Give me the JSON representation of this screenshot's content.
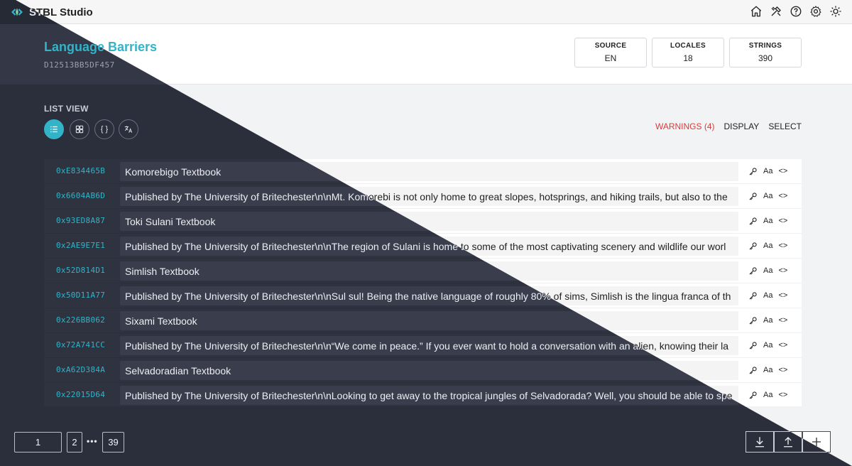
{
  "app": {
    "title": "STBL Studio"
  },
  "topbar": {
    "icons": [
      "home-icon",
      "tools-icon",
      "help-icon",
      "settings-icon",
      "theme-sun-icon"
    ]
  },
  "project": {
    "title": "Language Barriers",
    "id": "D12513BB5DF457"
  },
  "stats": [
    {
      "label": "SOURCE",
      "value": "EN"
    },
    {
      "label": "LOCALES",
      "value": "18"
    },
    {
      "label": "STRINGS",
      "value": "390"
    }
  ],
  "view": {
    "label": "LIST VIEW",
    "buttons": [
      {
        "name": "list-view",
        "glyph": "list-icon",
        "active": true
      },
      {
        "name": "grid-view",
        "glyph": "grid-icon",
        "active": false
      },
      {
        "name": "json-view",
        "glyph": "{ }",
        "active": false
      },
      {
        "name": "translate-view",
        "glyph": "translate-icon",
        "active": false
      }
    ]
  },
  "actions": {
    "warnings": "WARNINGS (4)",
    "display": "DISPLAY",
    "select": "SELECT"
  },
  "rows": [
    {
      "key": "0xE834465B",
      "value": "Komorebigo Textbook"
    },
    {
      "key": "0x6604AB6D",
      "value": "Published by The University of Britechester\\n\\nMt. Komorebi is not only home to great slopes, hotsprings, and hiking trails, but also to the"
    },
    {
      "key": "0x93ED8A87",
      "value": "Toki Sulani Textbook"
    },
    {
      "key": "0x2AE9E7E1",
      "value": "Published by The University of Britechester\\n\\nThe region of Sulani is home to some of the most captivating scenery and wildlife our worl"
    },
    {
      "key": "0x52D814D1",
      "value": "Simlish Textbook"
    },
    {
      "key": "0x50D11A77",
      "value": "Published by The University of Britechester\\n\\nSul sul! Being the native language of roughly 80% of sims, Simlish is the lingua franca of th"
    },
    {
      "key": "0x226BB062",
      "value": "Sixami Textbook"
    },
    {
      "key": "0x72A741CC",
      "value": "Published by The University of Britechester\\n\\n“We come in peace.” If you ever want to hold a conversation with an alien, knowing their la"
    },
    {
      "key": "0xA62D384A",
      "value": "Selvadoradian Textbook"
    },
    {
      "key": "0x22015D64",
      "value": "Published by The University of Britechester\\n\\nLooking to get away to the tropical jungles of Selvadorada? Well, you should be able to spe"
    }
  ],
  "row_icons": {
    "key_icon": "key-icon",
    "case": "Aa",
    "code": "<>"
  },
  "pagination": {
    "current": "1",
    "next": "2",
    "ellipsis": "•••",
    "last": "39"
  },
  "bottom_buttons": [
    "download-icon",
    "upload-icon",
    "add-icon"
  ],
  "colors": {
    "accent": "#33b3c8",
    "warning": "#d93b3b",
    "dark_bg": "#2b2f3b",
    "light_bg": "#f2f3f5"
  }
}
